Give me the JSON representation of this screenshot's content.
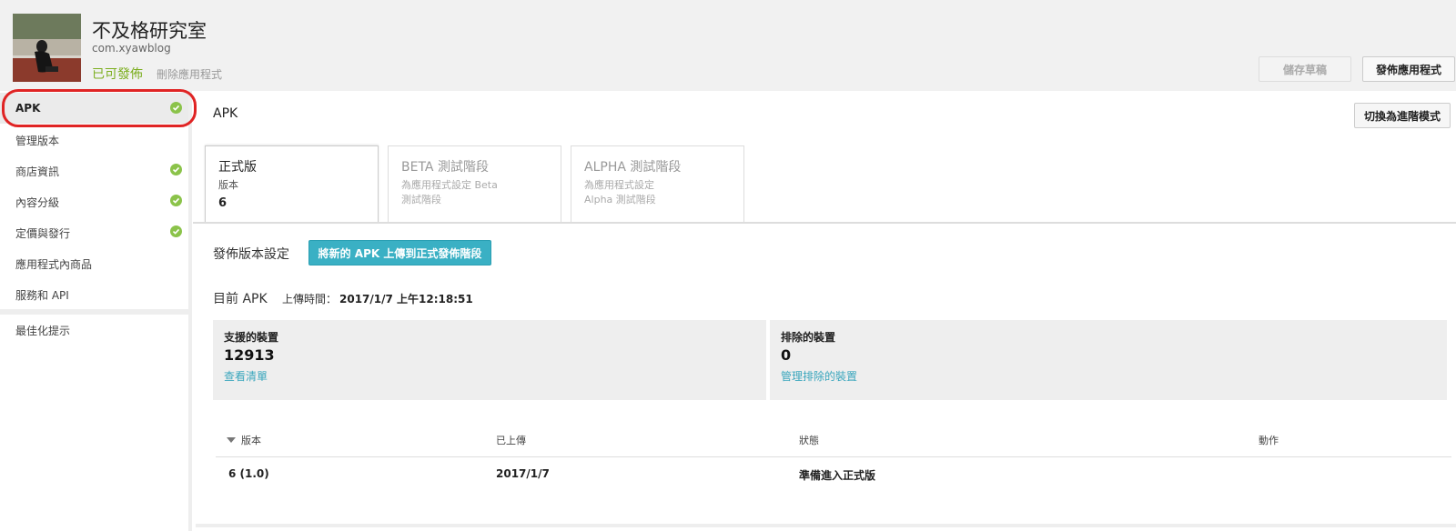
{
  "header": {
    "app_title": "不及格研究室",
    "app_package": "com.xyawblog",
    "status": "已可發佈",
    "delete_label": "刪除應用程式",
    "save_draft_label": "儲存草稿",
    "publish_label": "發佈應用程式"
  },
  "sidebar": {
    "items": [
      {
        "label": "APK",
        "checked": true
      },
      {
        "label": "管理版本",
        "checked": false
      },
      {
        "label": "商店資訊",
        "checked": true
      },
      {
        "label": "內容分級",
        "checked": true
      },
      {
        "label": "定價與發行",
        "checked": true
      },
      {
        "label": "應用程式內商品",
        "checked": false
      },
      {
        "label": "服務和 API",
        "checked": false
      },
      {
        "label": "最佳化提示",
        "checked": false
      }
    ]
  },
  "main": {
    "title": "APK",
    "advanced_mode_label": "切換為進階模式",
    "tabs": [
      {
        "title": "正式版",
        "subtitle": "版本",
        "number": "6"
      },
      {
        "title": "BETA 測試階段",
        "subtitle_line1": "為應用程式設定 Beta",
        "subtitle_line2": "測試階段"
      },
      {
        "title": "ALPHA 測試階段",
        "subtitle_line1": "為應用程式設定",
        "subtitle_line2": "Alpha 測試階段"
      }
    ],
    "release_settings_label": "發佈版本設定",
    "upload_button_label": "將新的 APK 上傳到正式發佈階段",
    "current_apk_label": "目前 APK",
    "upload_time_label": "上傳時間：",
    "upload_time_value": "2017/1/7 上午12:18:51",
    "cards": [
      {
        "label": "支援的裝置",
        "value": "12913",
        "link": "查看清單"
      },
      {
        "label": "排除的裝置",
        "value": "0",
        "link": "管理排除的裝置"
      }
    ],
    "table": {
      "headers": [
        "版本",
        "已上傳",
        "狀態",
        "動作"
      ],
      "rows": [
        {
          "version": "6 (1.0)",
          "uploaded": "2017/1/7",
          "status": "準備進入正式版",
          "action": ""
        }
      ]
    }
  },
  "colors": {
    "accent_teal": "#3ab0c4",
    "status_green": "#7cae1f",
    "check_green": "#8bc34a",
    "highlight_red": "#e02424"
  }
}
